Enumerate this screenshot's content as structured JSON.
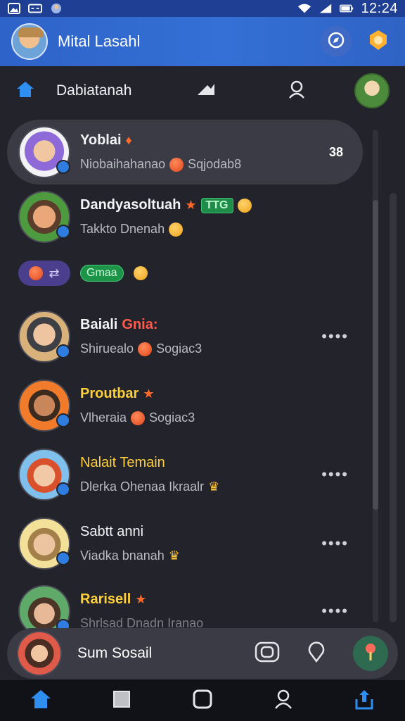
{
  "status_bar": {
    "time": "12:24",
    "left_icons": [
      "image-icon",
      "link-icon",
      "notification-avatar-icon"
    ],
    "right_icons": [
      "wifi-icon",
      "signal-icon",
      "battery-icon"
    ]
  },
  "header": {
    "title": "Mital Lasahl",
    "actions": [
      "compass-chat-icon",
      "award-badge-icon"
    ]
  },
  "subnav": {
    "title": "Dabiatanah",
    "icons": [
      "home-icon",
      "trend-arrow-icon",
      "profile-icon",
      "rank-avatar"
    ]
  },
  "conversations": [
    {
      "name": "Yoblai",
      "subtitle": "Niobaihahanao",
      "subtitle_extra": "Sqjodab8",
      "meta": "38",
      "active": true,
      "name_color": "default"
    },
    {
      "name": "Dandyasoltuah",
      "tag": "TTG",
      "subtitle": "Takkto Dnenah",
      "name_color": "default"
    },
    {
      "name": "Baiali",
      "name_extra": "Gnia:",
      "subtitle": "Shiruealo",
      "subtitle_extra": "Sogiac3",
      "name_color": "default"
    },
    {
      "name": "Proutbar",
      "subtitle": "Vlheraia",
      "subtitle_extra": "Sogiac3",
      "name_color": "yellow"
    },
    {
      "name": "Nalait Temain",
      "subtitle": "Dlerka Ohenaa Ikraalr",
      "name_color": "yellow"
    },
    {
      "name": "Sabtt anni",
      "subtitle": "Viadka bnanah",
      "name_color": "default"
    },
    {
      "name": "Rarisell",
      "subtitle": "Shrlsad Dnadn Iranao",
      "name_color": "yellow"
    }
  ],
  "chips": {
    "green_label": "Gmaa"
  },
  "mini_player": {
    "title": "Sum Sosail",
    "controls": [
      "instagram-icon",
      "location-pin-icon",
      "map-pin-icon"
    ]
  },
  "bottom_nav": [
    "home-icon",
    "stop-icon",
    "square-icon",
    "profile-icon",
    "share-icon"
  ],
  "colors": {
    "background": "#22232b",
    "header": "#3470d6",
    "accent_yellow": "#ffcf3a",
    "accent_red": "#ff5a4e",
    "active_row": "#3a3b45"
  }
}
